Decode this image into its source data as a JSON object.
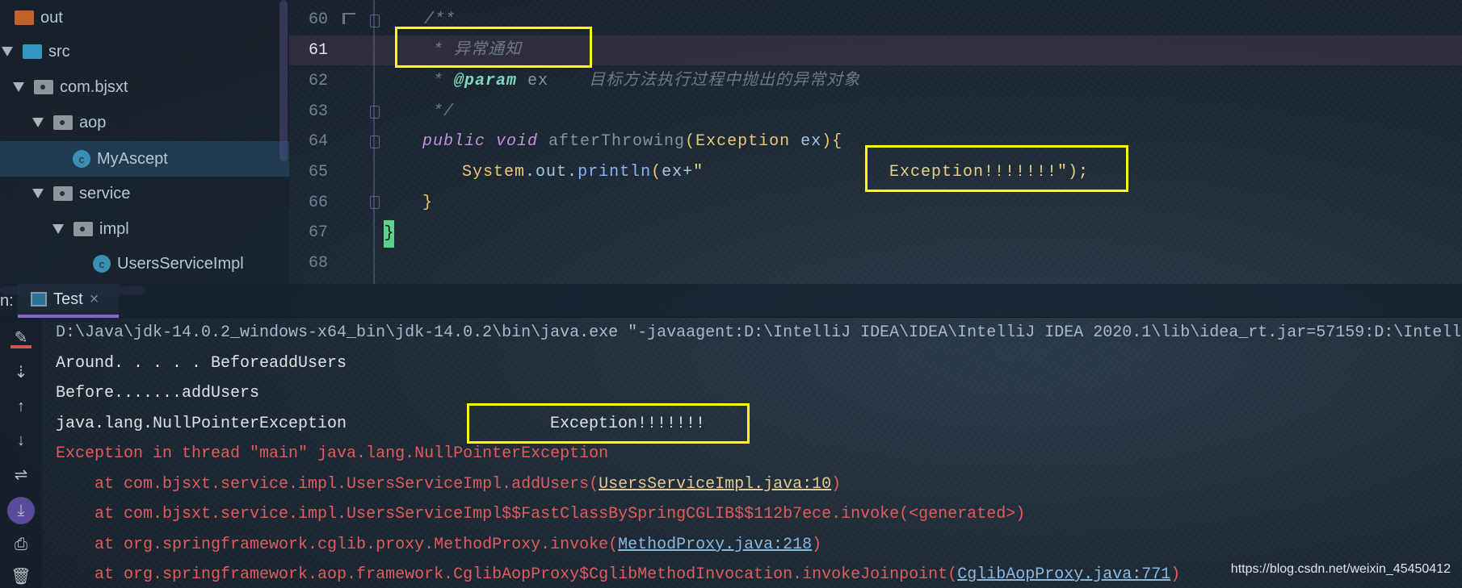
{
  "project_tree": {
    "items": [
      {
        "label": "out",
        "type": "folder-orange",
        "expanded": false
      },
      {
        "label": "src",
        "type": "folder-blue",
        "expanded": true
      },
      {
        "label": "com.bjsxt",
        "type": "package",
        "expanded": true
      },
      {
        "label": "aop",
        "type": "package",
        "expanded": true
      },
      {
        "label": "MyAscept",
        "type": "class",
        "selected": true
      },
      {
        "label": "service",
        "type": "package",
        "expanded": true
      },
      {
        "label": "impl",
        "type": "package",
        "expanded": true
      },
      {
        "label": "UsersServiceImpl",
        "type": "class"
      }
    ]
  },
  "editor": {
    "current_line": "61",
    "line_numbers": [
      "60",
      "61",
      "62",
      "63",
      "64",
      "65",
      "66",
      "67",
      "68"
    ],
    "lines": {
      "l60": "/**",
      "l61_star": "* ",
      "l61_text": "异常通知",
      "l62_star": "* ",
      "l62_tag": "@param",
      "l62_param": " ex",
      "l62_desc": "目标方法执行过程中抛出的异常对象",
      "l63": "*/",
      "l64_kw1": "public",
      "l64_kw2": " void",
      "l64_fn": " afterThrowing",
      "l64_p1": "(",
      "l64_ty": "Exception",
      "l64_arg": " ex",
      "l64_p2": "){",
      "l65_sys": "System",
      "l65_dot1": ".",
      "l65_out": "out",
      "l65_dot2": ".",
      "l65_println": "println",
      "l65_open": "(",
      "l65_ex": "ex+",
      "l65_q": "\"",
      "l65_str": "Exception!!!!!!!\");",
      "l66": "}",
      "l67": "}"
    }
  },
  "tool_window": {
    "label_prefix": "n:",
    "tab_label": "Test",
    "close": "×"
  },
  "console": {
    "lines": [
      {
        "text": "D:\\Java\\jdk-14.0.2_windows-x64_bin\\jdk-14.0.2\\bin\\java.exe \"-javaagent:D:\\IntelliJ IDEA\\IDEA\\IntelliJ IDEA 2020.1\\lib\\idea_rt.jar=57159:D:\\Intell"
      },
      {
        "text": "Around. . . . . BeforeaddUsers"
      },
      {
        "text": "Before.......addUsers"
      },
      {
        "text": "java.lang.NullPointerException"
      },
      {
        "text": "Exception in thread \"main\" java.lang.NullPointerException"
      }
    ],
    "npe_suffix": "Exception!!!!!!!",
    "stack": [
      {
        "prefix": "    at com.bjsxt.service.impl.UsersServiceImpl.addUsers(",
        "link": "UsersServiceImpl.java:10",
        "suffix": ")"
      },
      {
        "prefix": "    at com.bjsxt.service.impl.UsersServiceImpl$$FastClassBySpringCGLIB$$112b7ece.invoke(<generated>)",
        "link": "",
        "suffix": ""
      },
      {
        "prefix": "    at org.springframework.cglib.proxy.MethodProxy.invoke(",
        "link": "MethodProxy.java:218",
        "suffix": ")"
      },
      {
        "prefix": "    at org.springframework.aop.framework.CglibAopProxy$CglibMethodInvocation.invokeJoinpoint(",
        "link": "CglibAopProxy.java:771",
        "suffix": ")"
      }
    ]
  },
  "toolbar_icons": [
    "clear-icon",
    "sort-down-icon",
    "arrow-up-icon",
    "arrow-down-icon",
    "soft-wrap-icon",
    "scroll-to-end-icon",
    "print-icon",
    "trash-icon"
  ],
  "watermark": "https://blog.csdn.net/weixin_45450412",
  "colors": {
    "highlight_box": "#ffff00",
    "error_text": "#e35b5b",
    "selection": "#28506e",
    "tab_underline": "#8a63c9"
  }
}
